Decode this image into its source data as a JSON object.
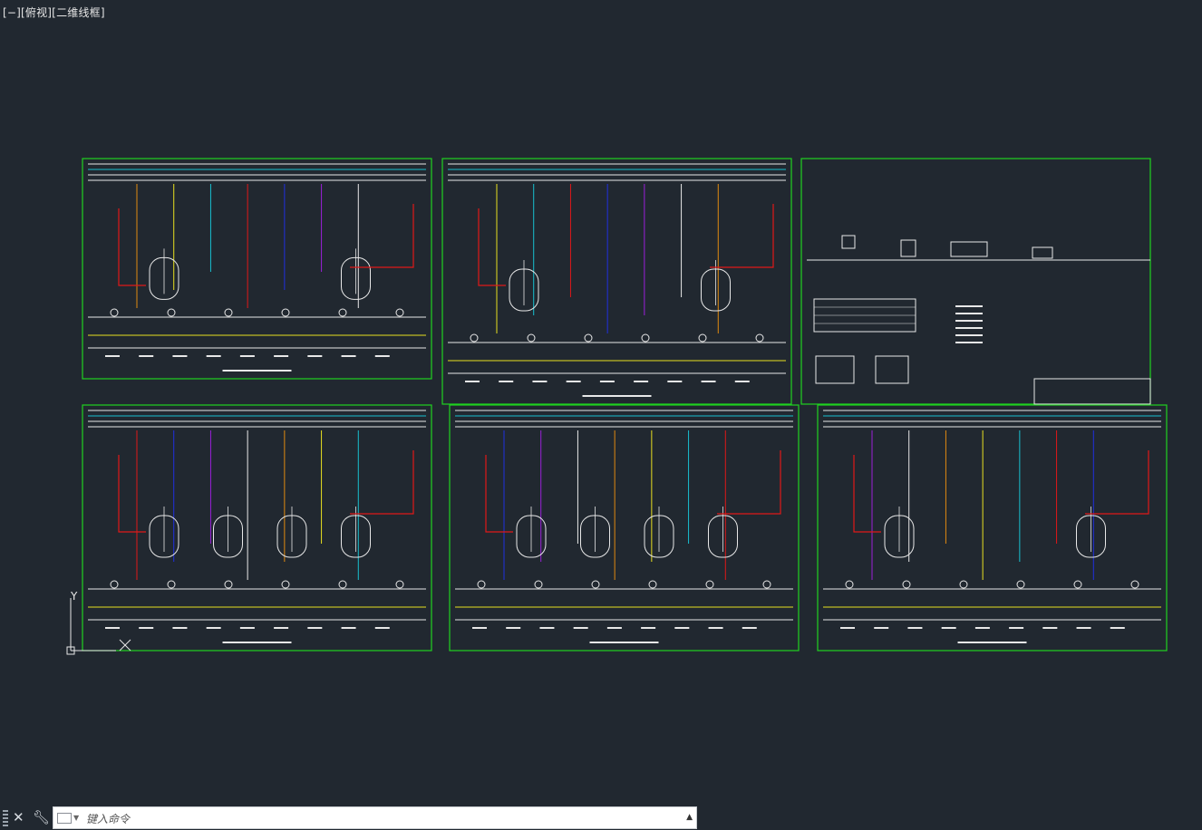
{
  "viewport": {
    "label": "[−][俯视][二维线框]"
  },
  "ucs": {
    "y_label": "Y"
  },
  "colors": {
    "background": "#212830",
    "frame": "#1fd21f",
    "pipe_red": "#e01818",
    "pipe_orange": "#e08a10",
    "pipe_yellow": "#e8e020",
    "pipe_cyan": "#18c0d0",
    "pipe_blue": "#2030e0",
    "pipe_purple": "#9a20d8",
    "pipe_green": "#20c030",
    "line_white": "#e8e8e8"
  },
  "commandline": {
    "close_icon": "close-icon",
    "customize_icon": "wrench-icon",
    "prompt_icon": "command-prompt-icon",
    "placeholder": "键入命令",
    "history_icon": "caret-up-icon"
  }
}
